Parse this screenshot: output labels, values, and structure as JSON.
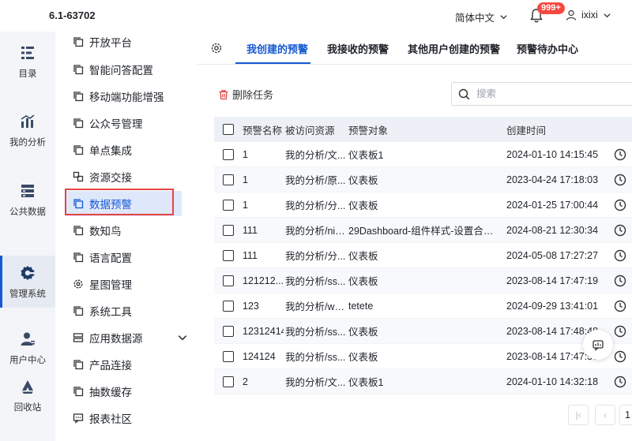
{
  "header": {
    "app_title": "6.1-63702",
    "language": "简体中文",
    "notification_badge": "999+",
    "username": "ixixi"
  },
  "rail": {
    "items": [
      {
        "label": "目录",
        "icon": "catalog-icon"
      },
      {
        "label": "我的分析",
        "icon": "chart-icon"
      },
      {
        "label": "公共数据",
        "icon": "database-icon"
      },
      {
        "label": "管理系统",
        "icon": "gear-icon",
        "active": true
      },
      {
        "label": "用户中心",
        "icon": "user-icon"
      },
      {
        "label": "回收站",
        "icon": "recycle-icon"
      }
    ]
  },
  "submenu": {
    "items": [
      {
        "label": "开放平台"
      },
      {
        "label": "智能问答配置"
      },
      {
        "label": "移动端功能增强"
      },
      {
        "label": "公众号管理"
      },
      {
        "label": "单点集成"
      },
      {
        "label": "资源交接"
      },
      {
        "label": "数据预警",
        "active": true
      },
      {
        "label": "数知鸟"
      },
      {
        "label": "语言配置"
      },
      {
        "label": "星图管理"
      },
      {
        "label": "系统工具"
      },
      {
        "label": "应用数据源"
      },
      {
        "label": "产品连接"
      },
      {
        "label": "抽数缓存"
      },
      {
        "label": "报表社区"
      }
    ]
  },
  "tabs": [
    {
      "label": "我创建的预警",
      "active": true
    },
    {
      "label": "我接收的预警"
    },
    {
      "label": "其他用户创建的预警"
    },
    {
      "label": "预警待办中心"
    }
  ],
  "toolbar": {
    "delete_label": "删除任务",
    "search_placeholder": "搜索"
  },
  "table": {
    "columns": [
      "预警名称",
      "被访问资源",
      "预警对象",
      "创建时间"
    ],
    "rows": [
      {
        "name": "1",
        "resource": "我的分析/文...",
        "target": "仪表板1",
        "time": "2024-01-10 14:15:45"
      },
      {
        "name": "1",
        "resource": "我的分析/原...",
        "target": "仪表板",
        "time": "2023-04-24 17:18:03"
      },
      {
        "name": "1",
        "resource": "我的分析/分...",
        "target": "仪表板",
        "time": "2024-01-25 17:00:44"
      },
      {
        "name": "111",
        "resource": "我的分析/nin...",
        "target": "29Dashboard-组件样式-设置合计...",
        "time": "2024-08-21 12:30:34"
      },
      {
        "name": "111",
        "resource": "我的分析/分...",
        "target": "仪表板",
        "time": "2024-05-08 17:27:27"
      },
      {
        "name": "121212...",
        "resource": "我的分析/ss...",
        "target": "仪表板",
        "time": "2023-08-14 17:47:19"
      },
      {
        "name": "123",
        "resource": "我的分析/wy...",
        "target": "tetete",
        "time": "2024-09-29 13:41:01"
      },
      {
        "name": "12312414",
        "resource": "我的分析/ss...",
        "target": "仪表板",
        "time": "2023-08-14 17:48:48"
      },
      {
        "name": "124124",
        "resource": "我的分析/ss...",
        "target": "仪表板",
        "time": "2023-08-14 17:47:57"
      },
      {
        "name": "2",
        "resource": "我的分析/文...",
        "target": "仪表板1",
        "time": "2024-01-10 14:32:18"
      }
    ]
  },
  "pagination": {
    "current_page": "1"
  },
  "colors": {
    "accent": "#1659d1",
    "badge": "#f5493f",
    "highlight_border": "#e64444"
  }
}
